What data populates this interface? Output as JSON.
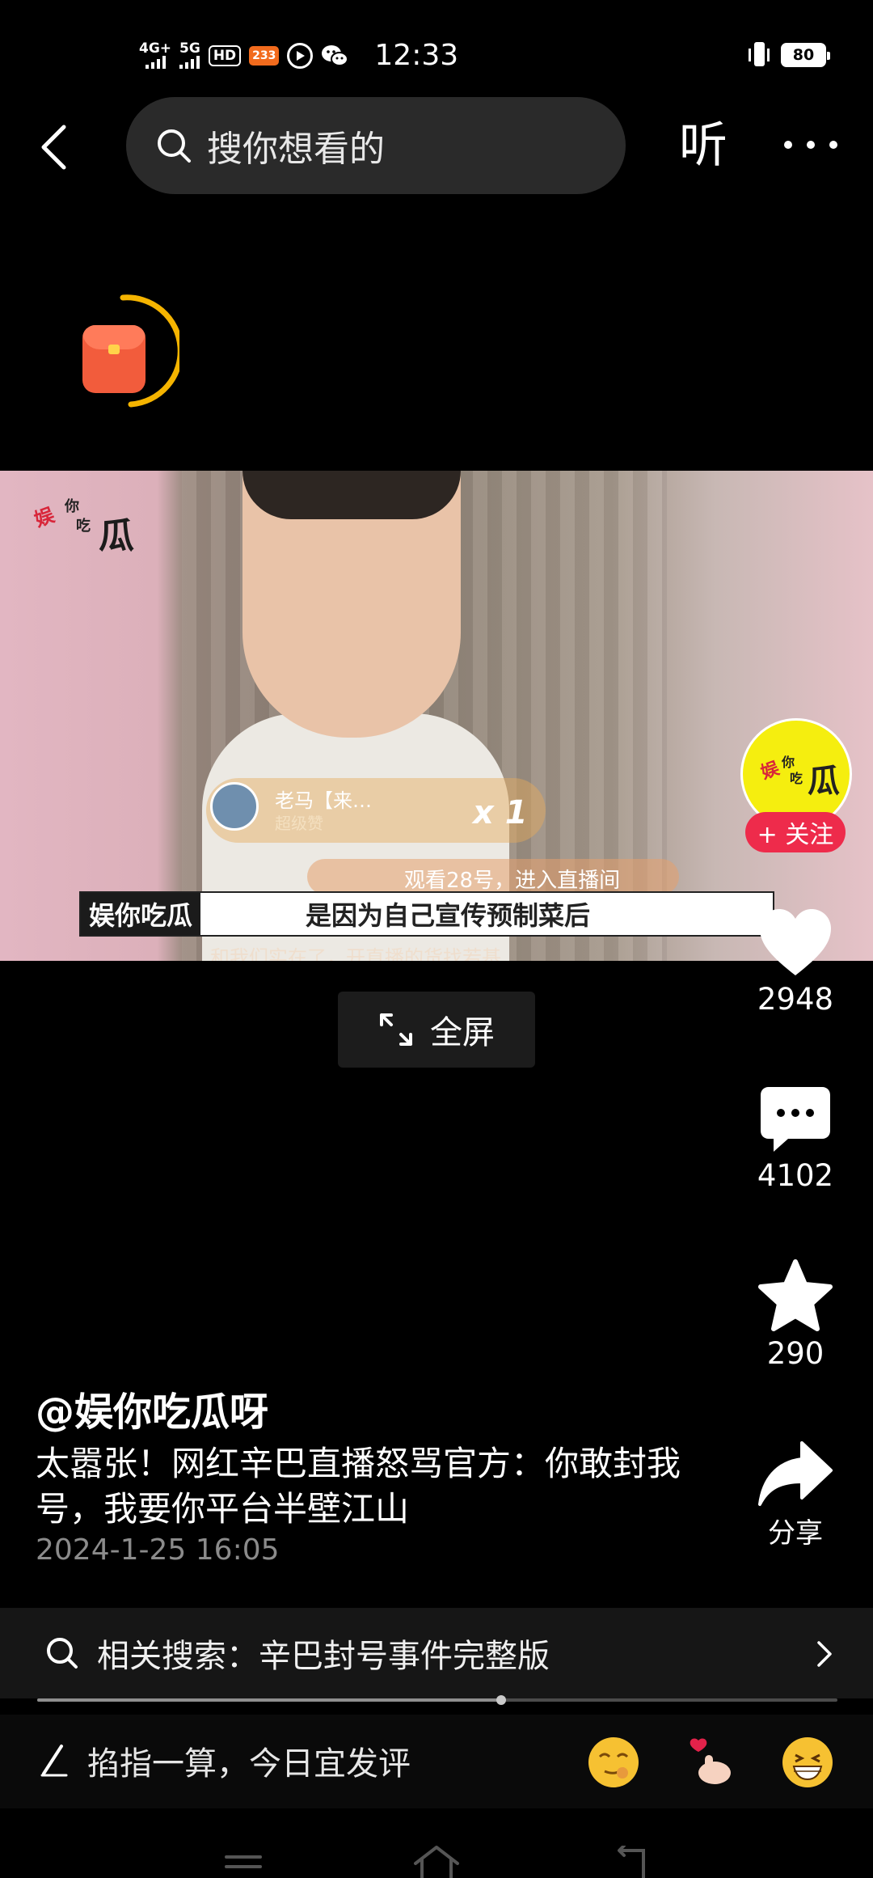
{
  "status_bar": {
    "network_1": "4G+",
    "network_2": "5G",
    "hd_badge": "HD",
    "app_badge": "233",
    "time": "12:33",
    "battery": "80"
  },
  "top_nav": {
    "search_placeholder": "搜你想看的",
    "listen_label": "听"
  },
  "video": {
    "watermark": [
      "娱",
      "你",
      "吃",
      "瓜"
    ],
    "overlay_user_name": "老马【来…",
    "overlay_user_sub": "超级赞",
    "overlay_multiplier": "x 1",
    "overlay_banner": "观看28号，进入直播间",
    "subtitle_tag": "娱你吃瓜",
    "subtitle_text": "是因为自己宣传预制菜后",
    "overlay_bottom": "和我们实在了，开直播的货找若基"
  },
  "fullscreen": {
    "label": "全屏"
  },
  "author": {
    "avatar_text": [
      "娱",
      "你",
      "吃",
      "瓜"
    ],
    "follow_label": "+ 关注",
    "handle": "@娱你吃瓜呀"
  },
  "actions": {
    "like_count": "2948",
    "comment_count": "4102",
    "favorite_count": "290",
    "share_label": "分享"
  },
  "caption": {
    "text": "太嚣张！网红辛巴直播怒骂官方：你敢封我号，我要你平台半壁江山",
    "timestamp": "2024-1-25 16:05"
  },
  "related_search": {
    "text": "相关搜索：辛巴封号事件完整版"
  },
  "progress": {
    "played_fraction": 0.58
  },
  "comment_bar": {
    "placeholder": "掐指一算，今日宜发评"
  },
  "icons": {
    "back": "chevron-left-icon",
    "search": "search-icon",
    "more": "more-icon",
    "like": "heart-icon",
    "comment": "comment-icon",
    "favorite": "star-icon",
    "share": "share-icon",
    "fullscreen": "expand-icon",
    "edit": "pen-icon"
  }
}
